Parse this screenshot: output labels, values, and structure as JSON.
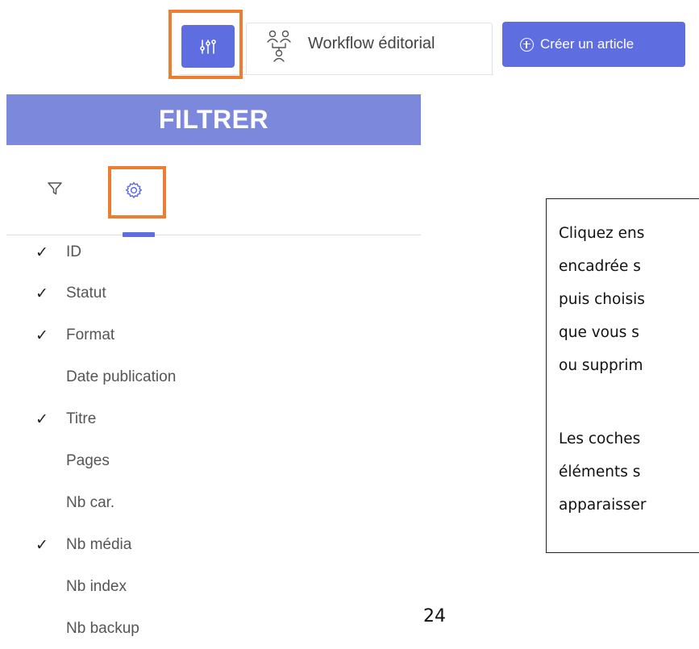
{
  "toolbar": {
    "workflow_label": "Workflow éditorial",
    "create_label": "Créer un article"
  },
  "panel": {
    "title": "FILTRER"
  },
  "columns": [
    {
      "label": "ID",
      "checked": true
    },
    {
      "label": "Statut",
      "checked": true
    },
    {
      "label": "Format",
      "checked": true
    },
    {
      "label": "Date publication",
      "checked": false
    },
    {
      "label": "Titre",
      "checked": true
    },
    {
      "label": "Pages",
      "checked": false
    },
    {
      "label": "Nb car.",
      "checked": false
    },
    {
      "label": "Nb média",
      "checked": true
    },
    {
      "label": "Nb index",
      "checked": false
    },
    {
      "label": "Nb backup",
      "checked": false
    }
  ],
  "check_glyph": "✓",
  "callout": {
    "paragraph1": [
      "Cliquez ens",
      "encadrée s",
      "puis choisis",
      "que vous s",
      "ou supprim"
    ],
    "paragraph2": [
      "Les coches",
      "éléments s",
      "apparaisser"
    ]
  },
  "page_number": "24",
  "colors": {
    "accent": "#5e6de0",
    "header": "#7b88dc",
    "highlight": "#ed7d31"
  },
  "icons": {
    "filter_toggle": "sliders-icon",
    "workflow": "workflow-icon",
    "create": "plus-circle-icon",
    "filter_tab": "funnel-icon",
    "settings_tab": "gear-icon"
  }
}
